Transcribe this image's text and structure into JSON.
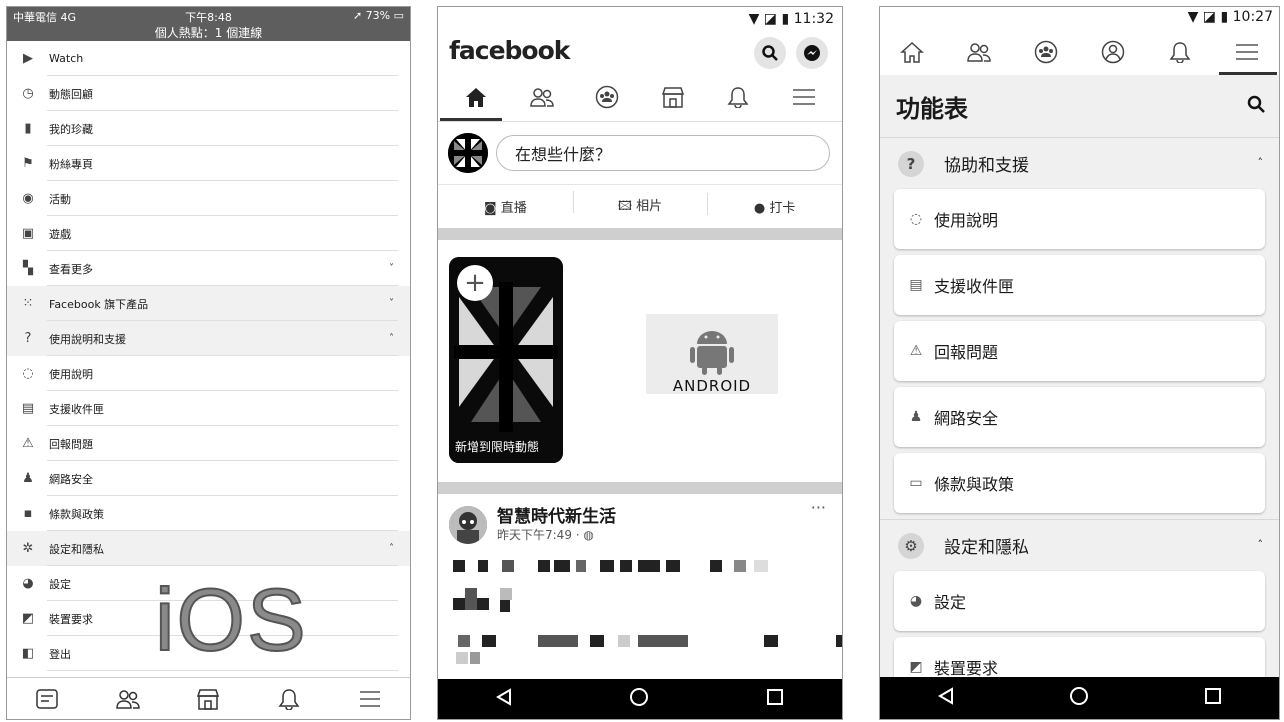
{
  "ios": {
    "status": {
      "carrier": "中華電信 4G",
      "time": "下午8:48",
      "battery": "73%",
      "hotspot": "個人熱點：1 個連線"
    },
    "menu": [
      {
        "label": "Watch",
        "icon": "watch-icon",
        "chevron": ""
      },
      {
        "label": "動態回顧",
        "icon": "memories-clock-icon",
        "chevron": ""
      },
      {
        "label": "我的珍藏",
        "icon": "bookmark-icon",
        "chevron": ""
      },
      {
        "label": "粉絲專頁",
        "icon": "flag-icon",
        "chevron": ""
      },
      {
        "label": "活動",
        "icon": "event-pin-icon",
        "chevron": ""
      },
      {
        "label": "遊戲",
        "icon": "games-icon",
        "chevron": ""
      },
      {
        "label": "查看更多",
        "icon": "see-more-icon",
        "chevron": "˅"
      },
      {
        "label": "Facebook 旗下產品",
        "icon": "products-grid-icon",
        "chevron": "˅"
      },
      {
        "label": "使用說明和支援",
        "icon": "help-question-icon",
        "chevron": "˄"
      },
      {
        "label": "使用說明",
        "icon": "lifebuoy-icon",
        "chevron": ""
      },
      {
        "label": "支援收件匣",
        "icon": "inbox-icon",
        "chevron": ""
      },
      {
        "label": "回報問題",
        "icon": "warning-icon",
        "chevron": ""
      },
      {
        "label": "網路安全",
        "icon": "safety-icon",
        "chevron": ""
      },
      {
        "label": "條款與政策",
        "icon": "policy-icon",
        "chevron": ""
      },
      {
        "label": "設定和隱私",
        "icon": "gear-icon",
        "chevron": "˄"
      },
      {
        "label": "設定",
        "icon": "settings-user-icon",
        "chevron": ""
      },
      {
        "label": "裝置要求",
        "icon": "device-request-icon",
        "chevron": ""
      },
      {
        "label": "登出",
        "icon": "logout-icon",
        "chevron": ""
      }
    ],
    "watermark": "iOS"
  },
  "android": {
    "status": {
      "time": "11:32"
    },
    "logo": "facebook",
    "composer_placeholder": "在想些什麼？",
    "actions": [
      "直播",
      "相片",
      "打卡"
    ],
    "story_caption": "新增到限時動態",
    "android_logo_text": "ANDROID",
    "post": {
      "author": "智慧時代新生活",
      "time": "昨天下午7:49 · ",
      "more": "···"
    }
  },
  "menu_page": {
    "status": {
      "time": "10:27"
    },
    "title": "功能表",
    "sections": [
      {
        "label": "協助和支援",
        "icon_text": "?"
      },
      {
        "label": "設定和隱私",
        "icon_text": "⚙"
      }
    ],
    "help_items": [
      "使用說明",
      "支援收件匣",
      "回報問題",
      "網路安全",
      "條款與政策"
    ],
    "settings_items": [
      "設定",
      "裝置要求"
    ]
  }
}
